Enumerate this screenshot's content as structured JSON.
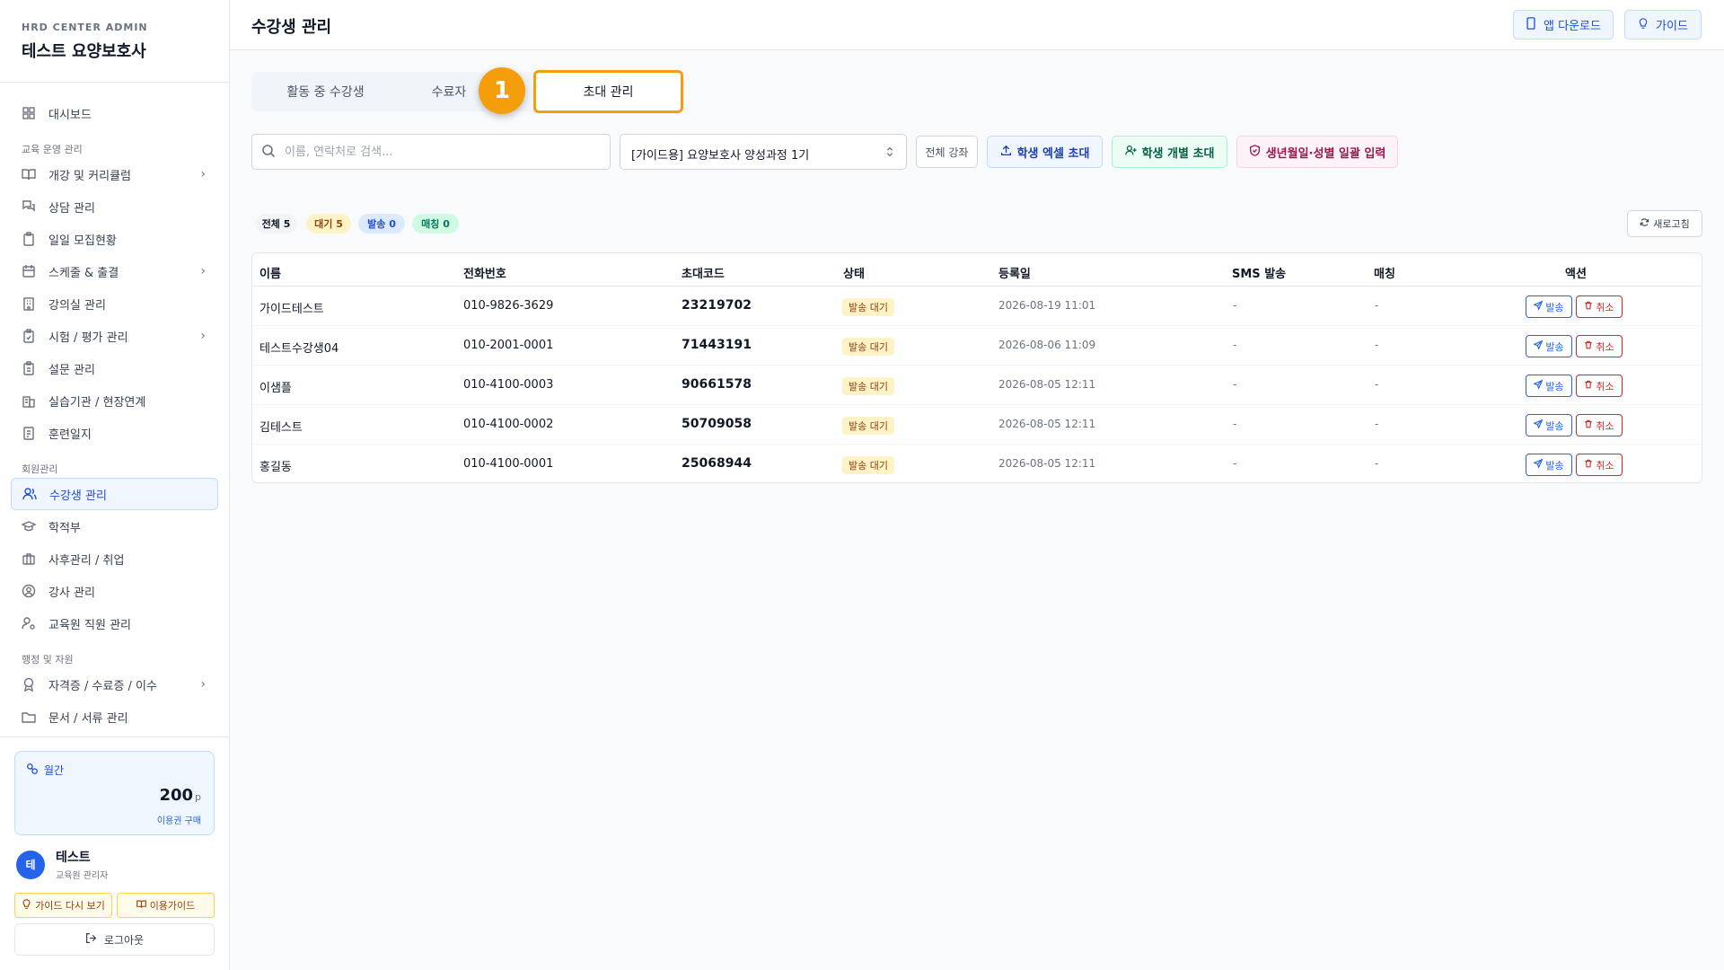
{
  "brand": {
    "subtitle": "HRD CENTER ADMIN",
    "title": "테스트 요양보호사"
  },
  "sidebar": {
    "items": [
      {
        "label": "대시보드"
      },
      {
        "section": "교육 운영 관리"
      },
      {
        "label": "개강 및 커리큘럼",
        "chevron": true
      },
      {
        "label": "상담 관리"
      },
      {
        "label": "일일 모집현황"
      },
      {
        "label": "스케줄 & 출결",
        "chevron": true
      },
      {
        "label": "강의실 관리"
      },
      {
        "label": "시험 / 평가 관리",
        "chevron": true
      },
      {
        "label": "설문 관리"
      },
      {
        "label": "실습기관 / 현장연계"
      },
      {
        "label": "훈련일지"
      },
      {
        "section": "회원관리"
      },
      {
        "label": "수강생 관리",
        "active": true
      },
      {
        "label": "학적부"
      },
      {
        "label": "사후관리 / 취업"
      },
      {
        "label": "강사 관리"
      },
      {
        "label": "교육원 직원 관리"
      },
      {
        "section": "행정 및 자원"
      },
      {
        "label": "자격증 / 수료증 / 이수",
        "chevron": true
      },
      {
        "label": "문서 / 서류 관리"
      }
    ],
    "section_labels": [
      "교육 운영 관리",
      "회원관리",
      "행정 및 자원"
    ],
    "labels": [
      "대시보드",
      "개강 및 커리큘럼",
      "상담 관리",
      "일일 모집현황",
      "스케줄 & 출결",
      "강의실 관리",
      "시험 / 평가 관리",
      "설문 관리",
      "실습기관 / 현장연계",
      "훈련일지",
      "수강생 관리",
      "학적부",
      "사후관리 / 취업",
      "강사 관리",
      "교육원 직원 관리",
      "자격증 / 수료증 / 이수",
      "문서 / 서류 관리"
    ]
  },
  "plan": {
    "label": "월간",
    "points": "200",
    "unit": "p",
    "buy_label": "이용권 구매"
  },
  "user": {
    "initial": "테",
    "name": "테스트",
    "role": "교육원 관리자"
  },
  "footer_buttons": {
    "guide_again": "가이드 다시 보기",
    "usage_guide": "이용가이드",
    "logout": "로그아웃"
  },
  "header": {
    "title": "수강생 관리",
    "app_download": "앱 다운로드",
    "guide": "가이드"
  },
  "tabs": {
    "active_students": "활동 중 수강생",
    "completed": "수료자",
    "invite": "초대 관리",
    "step_number": "1"
  },
  "filters": {
    "search_placeholder": "이름, 연락처로 검색...",
    "course_selected": "[가이드용] 요양보호사 양성과정 1기",
    "all_courses": "전체 강좌",
    "excel_invite": "학생 엑셀 초대",
    "single_invite": "학생 개별 초대",
    "bulk_input": "생년월일·성별 일괄 입력"
  },
  "counts": {
    "all_label": "전체",
    "all": "5",
    "waiting_label": "대기",
    "waiting": "5",
    "sent_label": "발송",
    "sent": "0",
    "matched_label": "매칭",
    "matched": "0"
  },
  "refresh_label": "새로고침",
  "table": {
    "columns": [
      "이름",
      "전화번호",
      "초대코드",
      "상태",
      "등록일",
      "SMS 발송",
      "매칭",
      "액션"
    ],
    "rows": [
      {
        "name": "가이드테스트",
        "phone": "010-9826-3629",
        "code": "23219702",
        "status": "발송 대기",
        "date": "2026-08-19 11:01",
        "sms": "-",
        "match": "-"
      },
      {
        "name": "테스트수강생04",
        "phone": "010-2001-0001",
        "code": "71443191",
        "status": "발송 대기",
        "date": "2026-08-06 11:09",
        "sms": "-",
        "match": "-"
      },
      {
        "name": "이샘플",
        "phone": "010-4100-0003",
        "code": "90661578",
        "status": "발송 대기",
        "date": "2026-08-05 12:11",
        "sms": "-",
        "match": "-"
      },
      {
        "name": "김테스트",
        "phone": "010-4100-0002",
        "code": "50709058",
        "status": "발송 대기",
        "date": "2026-08-05 12:11",
        "sms": "-",
        "match": "-"
      },
      {
        "name": "홍길동",
        "phone": "010-4100-0001",
        "code": "25068944",
        "status": "발송 대기",
        "date": "2026-08-05 12:11",
        "sms": "-",
        "match": "-"
      }
    ],
    "send_label": "발송",
    "cancel_label": "취소"
  },
  "colors": {
    "accent": "#2563eb",
    "highlight": "#f59e0b",
    "waiting_bg": "#fef3c7",
    "danger": "#dc2626",
    "success": "#059669",
    "pink": "#be185d"
  }
}
